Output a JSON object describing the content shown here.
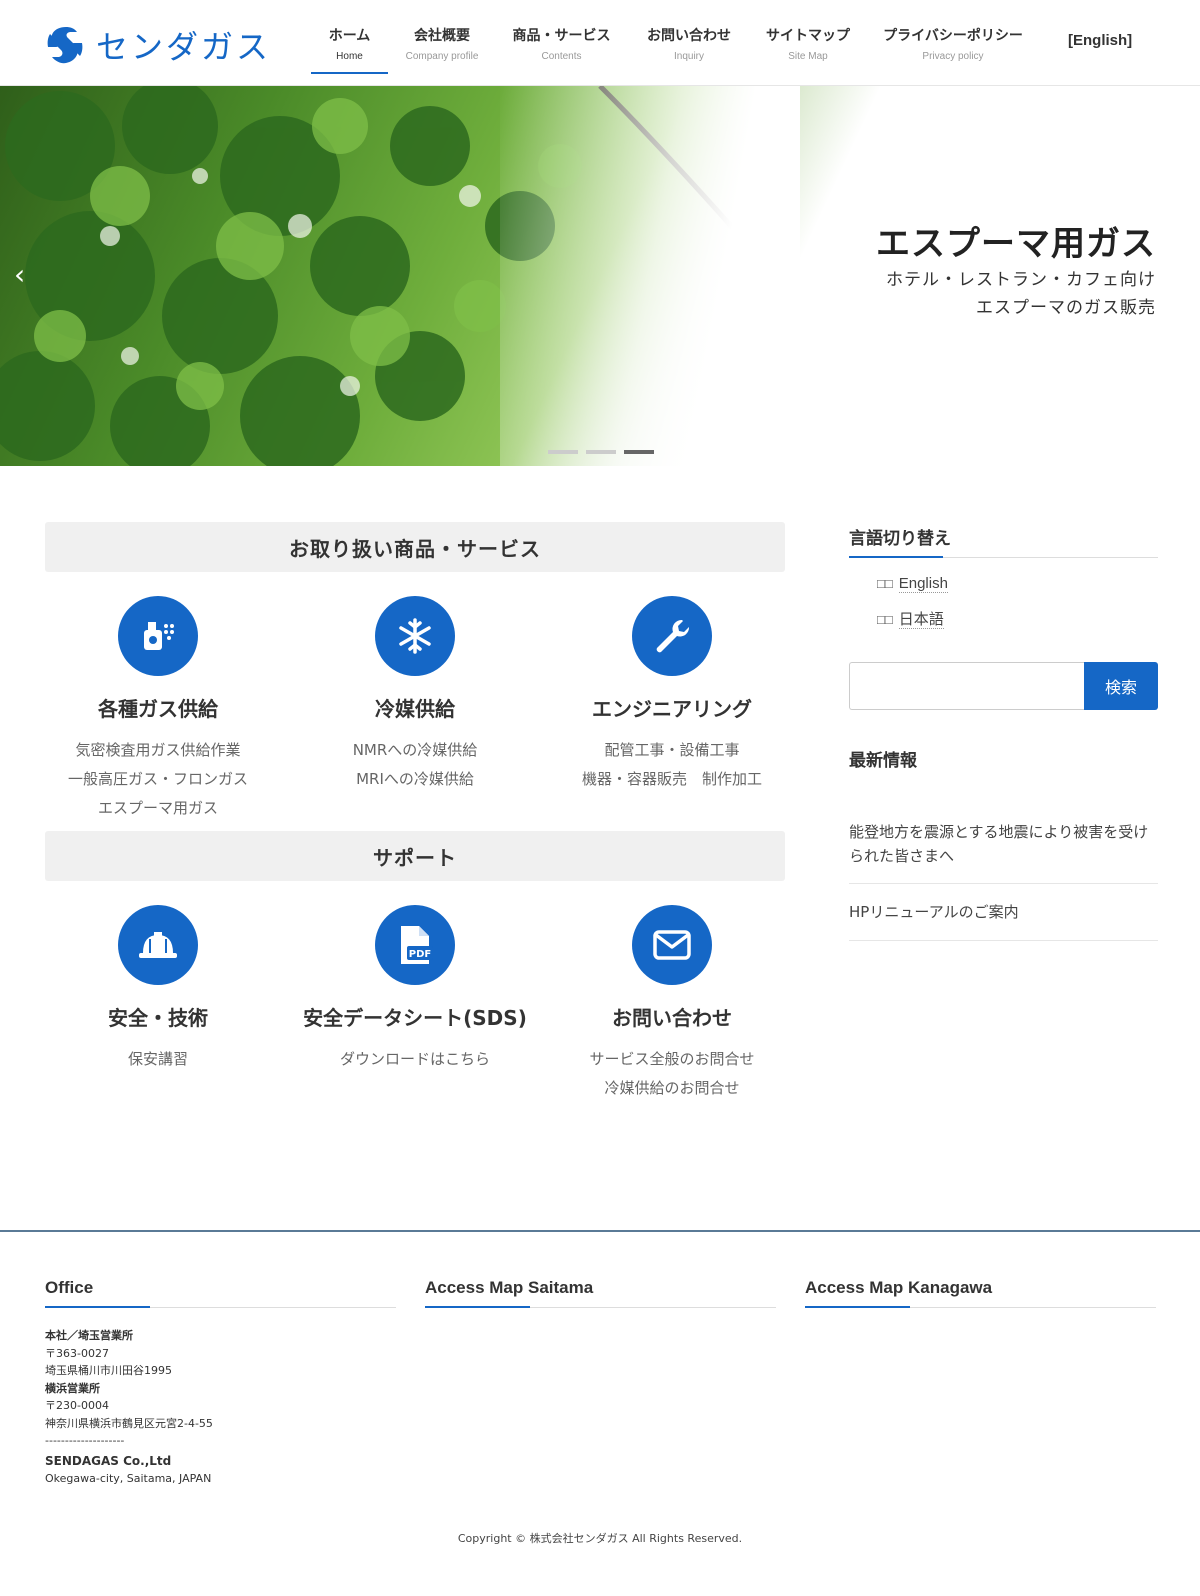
{
  "header": {
    "logo_text": "センダガス",
    "nav": [
      {
        "jp": "ホーム",
        "en": "Home"
      },
      {
        "jp": "会社概要",
        "en": "Company profile"
      },
      {
        "jp": "商品・サービス",
        "en": "Contents"
      },
      {
        "jp": "お問い合わせ",
        "en": "Inquiry"
      },
      {
        "jp": "サイトマップ",
        "en": "Site Map"
      },
      {
        "jp": "プライバシーポリシー",
        "en": "Privacy policy"
      }
    ],
    "english_link": "[English]"
  },
  "hero": {
    "title": "エスプーマ用ガス",
    "sub_line1": "ホテル・レストラン・カフェ向け",
    "sub_line2": "エスプーマのガス販売",
    "slide_count": 3,
    "active_slide": 3
  },
  "products": {
    "heading": "お取り扱い商品・サービス",
    "items": [
      {
        "icon": "gas-canister-icon",
        "title": "各種ガス供給",
        "lines": [
          "気密検査用ガス供給作業",
          "一般高圧ガス・フロンガス",
          "エスプーマ用ガス"
        ]
      },
      {
        "icon": "snowflake-icon",
        "title": "冷媒供給",
        "lines": [
          "NMRへの冷媒供給",
          "MRIへの冷媒供給"
        ]
      },
      {
        "icon": "wrench-icon",
        "title": "エンジニアリング",
        "lines": [
          "配管工事・設備工事",
          "機器・容器販売　制作加工"
        ]
      }
    ]
  },
  "support": {
    "heading": "サポート",
    "items": [
      {
        "icon": "hard-hat-icon",
        "title": "安全・技術",
        "lines": [
          "保安講習"
        ]
      },
      {
        "icon": "pdf-file-icon",
        "title": "安全データシート(SDS)",
        "lines": [
          "ダウンロードはこちら"
        ]
      },
      {
        "icon": "envelope-icon",
        "title": "お問い合わせ",
        "lines": [
          "サービス全般のお問合せ",
          "冷媒供給のお問合せ"
        ]
      }
    ]
  },
  "sidebar": {
    "lang_title": "言語切り替え",
    "lang_links": [
      "English",
      "日本語"
    ],
    "search_button": "検索",
    "search_placeholder": "",
    "news_title": "最新情報",
    "news": [
      "能登地方を震源とする地震により被害を受けられた皆さまへ",
      "HPリニューアルのご案内"
    ]
  },
  "footer": {
    "office_title": "Office",
    "saitama_title": "Access Map Saitama",
    "kanagawa_title": "Access Map Kanagawa",
    "office": {
      "hq_label": "本社／埼玉営業所",
      "hq_zip": "〒363-0027",
      "hq_address": "埼玉県桶川市川田谷1995",
      "yokohama_label": "横浜営業所",
      "yokohama_zip": "〒230-0004",
      "yokohama_address": "神奈川県横浜市鶴見区元宮2-4-55",
      "separator": "--------------------",
      "company": "SENDAGAS Co.,Ltd",
      "company_address": "Okegawa-city, Saitama, JAPAN"
    },
    "copyright": "Copyright © 株式会社センダガス All Rights Reserved."
  },
  "colors": {
    "brand_blue": "#1567c6",
    "section_bg": "#f0f0f0",
    "footer_line": "#5a7a96"
  }
}
